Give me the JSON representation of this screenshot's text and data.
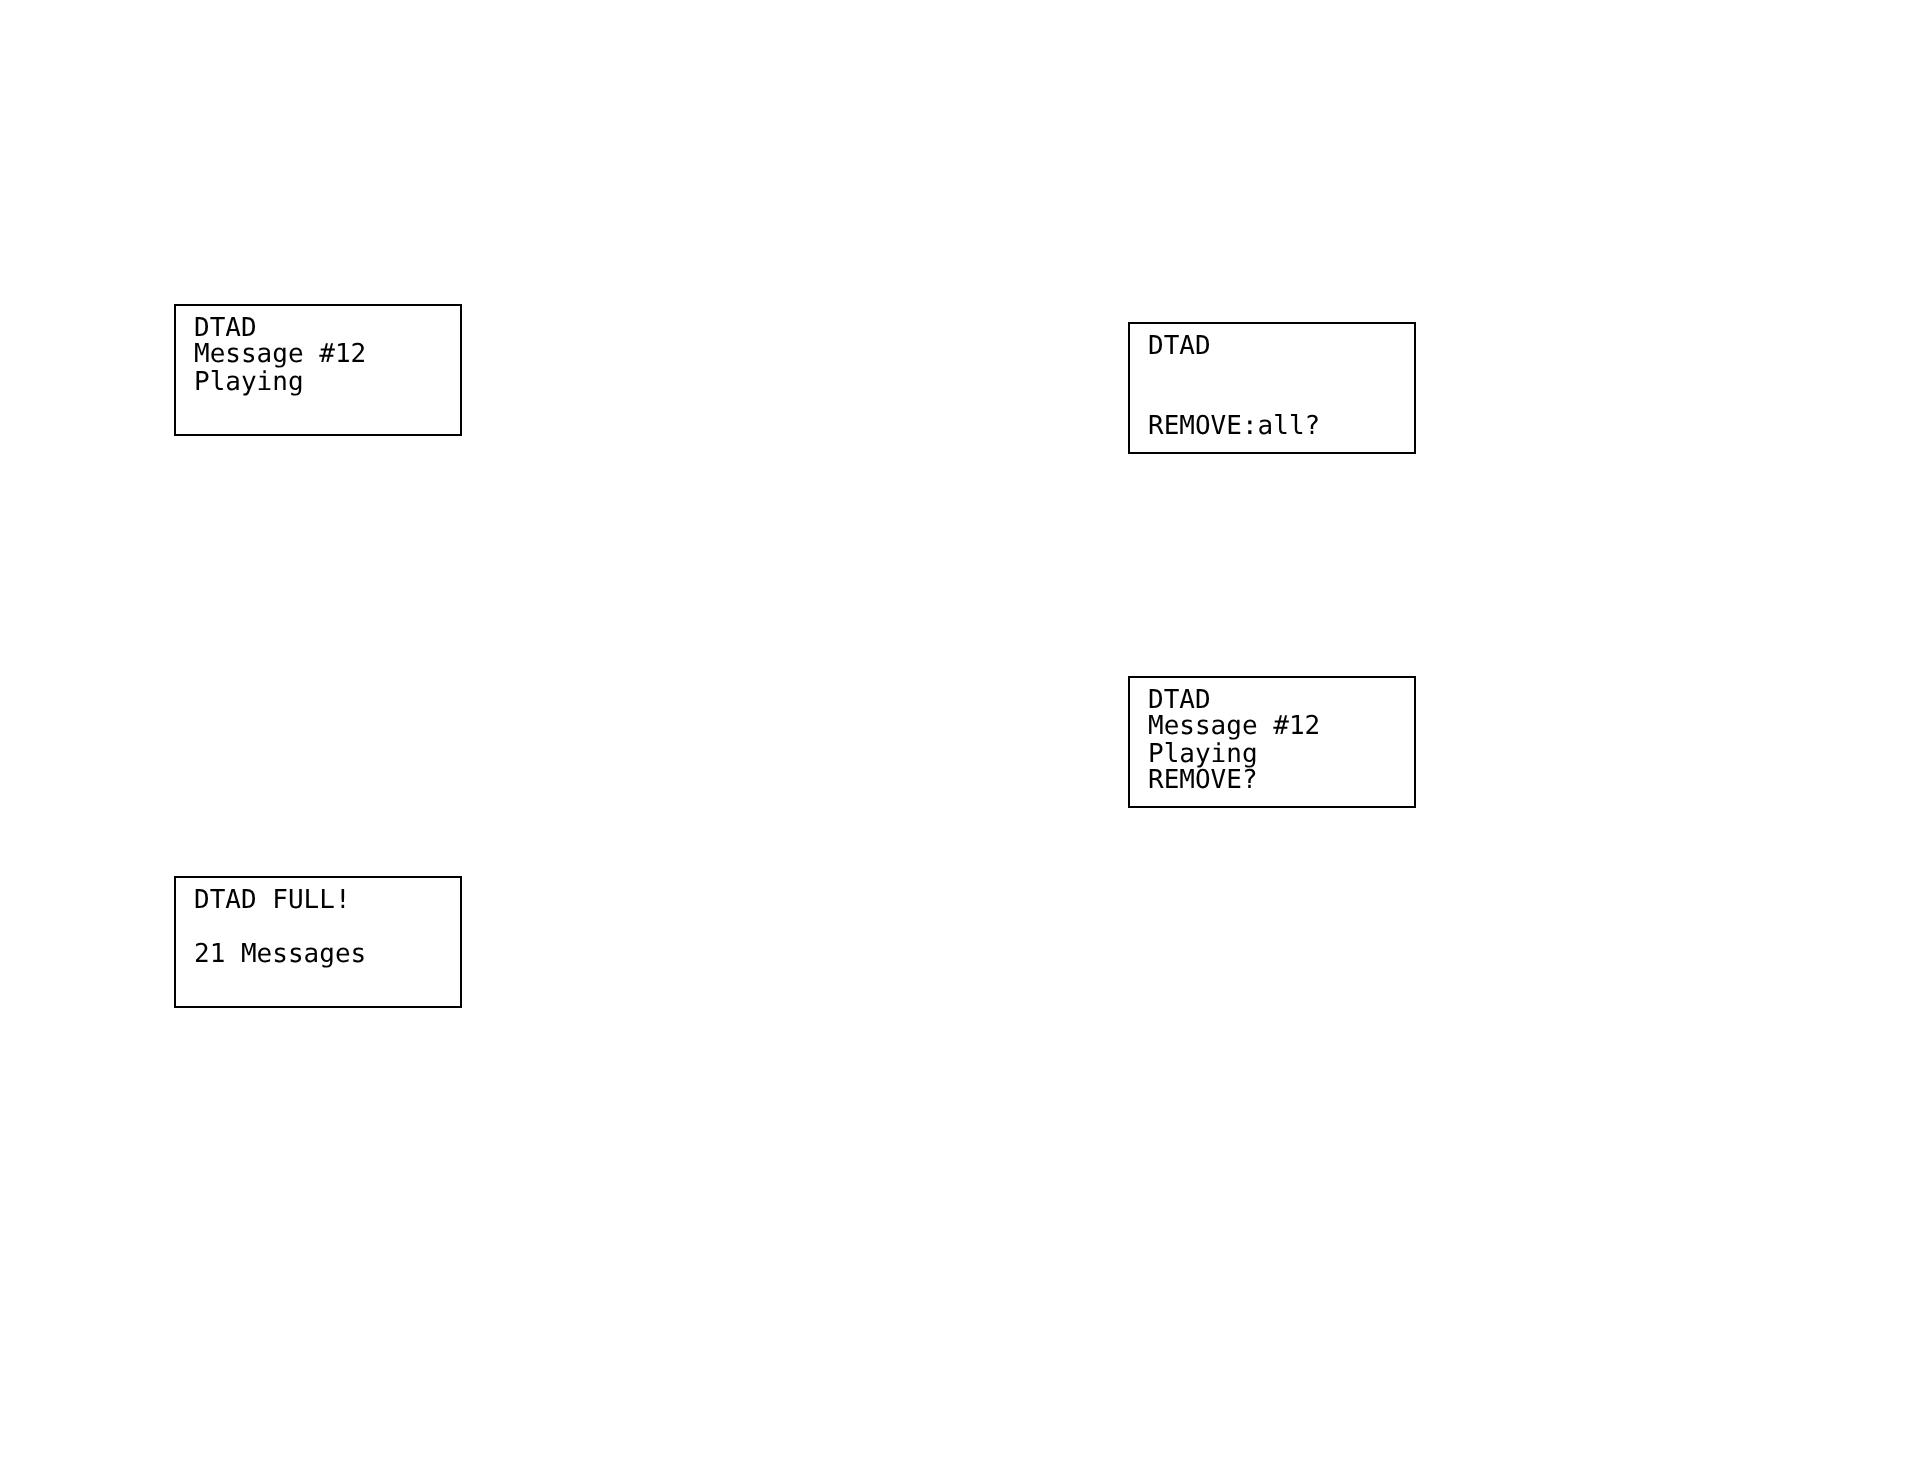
{
  "left_displays": [
    {
      "line_1": "DTAD",
      "line_2": "Message #12",
      "line_3": "Playing"
    },
    {
      "line_1": "DTAD FULL!",
      "line_3": "21 Messages"
    }
  ],
  "right_displays": [
    {
      "line_1": "DTAD",
      "line_4": "REMOVE:all?"
    },
    {
      "line_1": "DTAD",
      "line_2": "Message #12",
      "line_3": "Playing",
      "line_4": "REMOVE?"
    }
  ]
}
